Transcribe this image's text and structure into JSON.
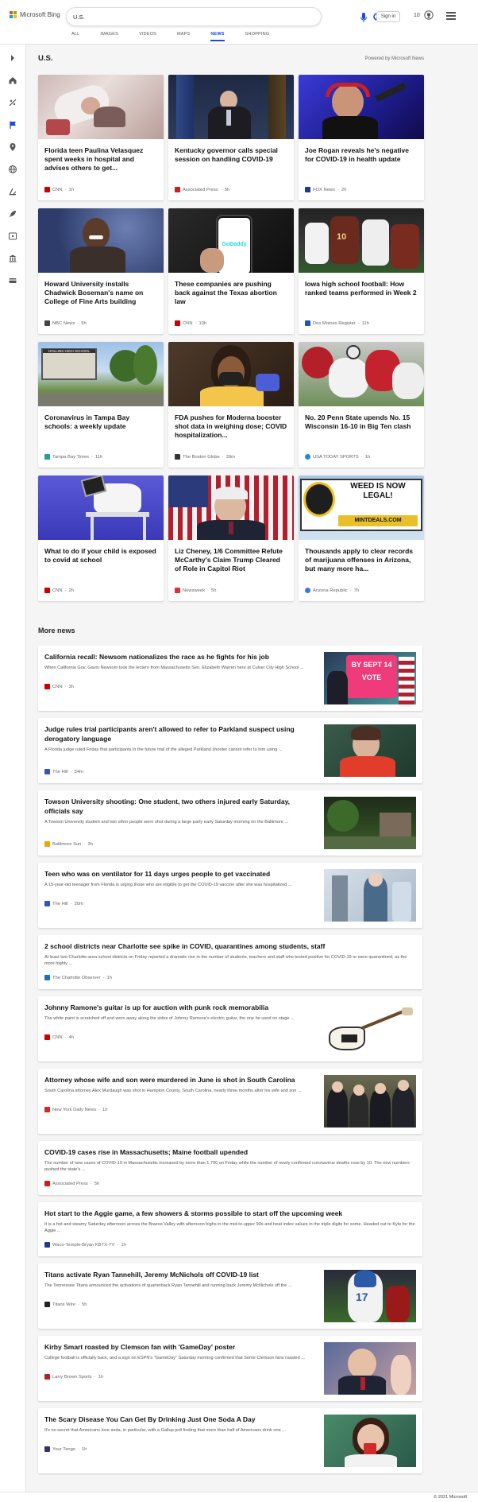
{
  "header": {
    "brand": "Microsoft Bing",
    "search_value": "U.S.",
    "signin_label": "Sign in",
    "rewards_count": "10",
    "tabs": [
      {
        "label": "ALL"
      },
      {
        "label": "IMAGES"
      },
      {
        "label": "VIDEOS"
      },
      {
        "label": "MAPS"
      },
      {
        "label": "NEWS"
      },
      {
        "label": "SHOPPING"
      }
    ],
    "active_tab": "NEWS",
    "accent_color": "#174ae4"
  },
  "sidebar": {
    "icons": [
      "expand-arrow-icon",
      "home-icon",
      "sports-icon",
      "flag-icon",
      "location-icon",
      "globe-icon",
      "science-icon",
      "rocket-icon",
      "entertainment-icon",
      "business-icon",
      "card-icon"
    ]
  },
  "main": {
    "section_title": "U.S.",
    "powered_by": "Powered by Microsoft News",
    "cards": [
      {
        "title": "Florida teen Paulina Velasquez spent weeks in hospital and advises others to get...",
        "source": "CNN",
        "age": "1h",
        "source_color": "#cc0000"
      },
      {
        "title": "Kentucky governor calls special session on handling COVID-19",
        "source": "Associated Press",
        "age": "5h",
        "source_color": "#d11a1a"
      },
      {
        "title": "Joe Rogan reveals he's negative for COVID-19 in health update",
        "source": "FOX News",
        "age": "2h",
        "source_color": "#1e3a8a"
      },
      {
        "title": "Howard University installs Chadwick Boseman's name on College of Fine Arts building",
        "source": "NBC News",
        "age": "5h",
        "source_color": "#444444"
      },
      {
        "title": "These companies are pushing back against the Texas abortion law",
        "source": "CNN",
        "age": "10h",
        "source_color": "#cc0000"
      },
      {
        "title": "Iowa high school football: How ranked teams performed in Week 2",
        "source": "Des Moines Register",
        "age": "11h",
        "source_color": "#2255aa"
      },
      {
        "title": "Coronavirus in Tampa Bay schools: a weekly update",
        "source": "Tampa Bay Times",
        "age": "11h",
        "source_color": "#2a9d8f"
      },
      {
        "title": "FDA pushes for Moderna booster shot data in weighing dose; COVID hospitalization...",
        "source": "The Boston Globe",
        "age": "39m",
        "source_color": "#333333"
      },
      {
        "title": "No. 20 Penn State upends No. 15 Wisconsin 16-10 in Big Ten clash",
        "source": "USA TODAY SPORTS",
        "age": "1h",
        "source_color": "#1c8bd6"
      },
      {
        "title": "What to do if your child is exposed to covid at school",
        "source": "CNN",
        "age": "2h",
        "source_color": "#cc0000"
      },
      {
        "title": "Liz Cheney, 1/6 Committee Refute McCarthy's Claim Trump Cleared of Role in Capitol Riot",
        "source": "Newsweek",
        "age": "5h",
        "source_color": "#e03131"
      },
      {
        "title": "Thousands apply to clear records of marijuana offenses in Arizona, but many more ha...",
        "source": "Arizona Republic",
        "age": "7h",
        "source_color": "#3a7bd5"
      }
    ],
    "more_news_title": "More news",
    "more_news": [
      {
        "title": "California recall: Newsom nationalizes the race as he fights for his job",
        "snippet": "When California Gov. Gavin Newsom took the lectern from Massachusetts Sen. Elizabeth Warren here at Culver City High School ...",
        "source": "CNN",
        "age": "3h",
        "source_color": "#cc0000",
        "image_text": "BY SEPT 14 VOTE"
      },
      {
        "title": "Judge rules trial participants aren't allowed to refer to Parkland suspect using derogatory language",
        "snippet": "A Florida judge ruled Friday that participants in the future trial of the alleged Parkland shooter cannot refer to him using ...",
        "source": "The Hill",
        "age": "54m",
        "source_color": "#3355bb"
      },
      {
        "title": "Towson University shooting: One student, two others injured early Saturday, officials say",
        "snippet": "A Towson University student and two other people were shot during a large party early Saturday morning on the Baltimore ...",
        "source": "Baltimore Sun",
        "age": "3h",
        "source_color": "#f0a500"
      },
      {
        "title": "Teen who was on ventilator for 11 days urges people to get vaccinated",
        "snippet": "A 15-year-old teenager from Florida is urging those who are eligible to get the COVID-19 vaccine after she was hospitalized ...",
        "source": "The Hill",
        "age": "20m",
        "source_color": "#3355bb"
      },
      {
        "title": "2 school districts near Charlotte see spike in COVID, quarantines among students, staff",
        "snippet": "At least two Charlotte-area school districts on Friday reported a dramatic rise in the number of students, teachers and staff who tested positive for COVID-19 or were quarantined, as the more highly ...",
        "source": "The Charlotte Observer",
        "age": "1h",
        "source_color": "#1a73b8"
      },
      {
        "title": "Johnny Ramone's guitar is up for auction with punk rock memorabilia",
        "snippet": "The white paint is scratched off and worn away along the sides of Johnny Ramone's electric guitar, the one he used on stage ...",
        "source": "CNN",
        "age": "4h",
        "source_color": "#cc0000"
      },
      {
        "title": "Attorney whose wife and son were murdered in June is shot in South Carolina",
        "snippet": "South Carolina attorney Alex Murdaugh was shot in Hampton County, South Carolina, nearly three months after his wife and son ...",
        "source": "New York Daily News",
        "age": "1h",
        "source_color": "#d62828"
      },
      {
        "title": "COVID-19 cases rise in Massachusetts; Maine football upended",
        "snippet": "The number of new cases of COVID-19 in Massachusetts increased by more than 1,700 on Friday while the number of newly confirmed coronavirus deaths rose by 10. The new numbers pushed the state's ...",
        "source": "Associated Press",
        "age": "5h",
        "source_color": "#d11a1a"
      },
      {
        "title": "Hot start to the Aggie game, a few showers & storms possible to start off the upcoming week",
        "snippet": "It is a hot and steamy Saturday afternoon across the Brazos Valley with afternoon highs in the mid-to-upper 90s and heat index values in the triple digits for some. Headed out to Kyle for the Aggie ...",
        "source": "Waco-Temple-Bryan KBTX-TV",
        "age": "1h",
        "source_color": "#1d3c8f"
      },
      {
        "title": "Titans activate Ryan Tannehill, Jeremy McNichols off COVID-19 list",
        "snippet": "The Tennessee Titans announced the activations of quarterback Ryan Tannehill and running back Jeremy McNichols off the ...",
        "source": "Titans Wire",
        "age": "5h",
        "source_color": "#222222"
      },
      {
        "title": "Kirby Smart roasted by Clemson fan with 'GameDay' poster",
        "snippet": "College football is officially back, and a sign on ESPN's \"GameDay\" Saturday morning confirmed that Some Clemson fans roasted ...",
        "source": "Larry Brown Sports",
        "age": "1h",
        "source_color": "#b22222"
      },
      {
        "title": "The Scary Disease You Can Get By Drinking Just One Soda A Day",
        "snippet": "It's no secret that Americans love soda, in particular, with a Gallup poll finding that more than half of Americans drink one ...",
        "source": "Your Tango",
        "age": "1h",
        "source_color": "#333366"
      }
    ]
  },
  "images": {
    "card_weed_sign": "WEED IS NOW LEGAL!",
    "card_weed_url": "MINTDEALS.COM",
    "card_godaddy": "GoDaddy",
    "card_school_sign": "HOLLINS HIGH SCHOOL"
  },
  "footer": {
    "copyright": "© 2021 Microsoft"
  }
}
